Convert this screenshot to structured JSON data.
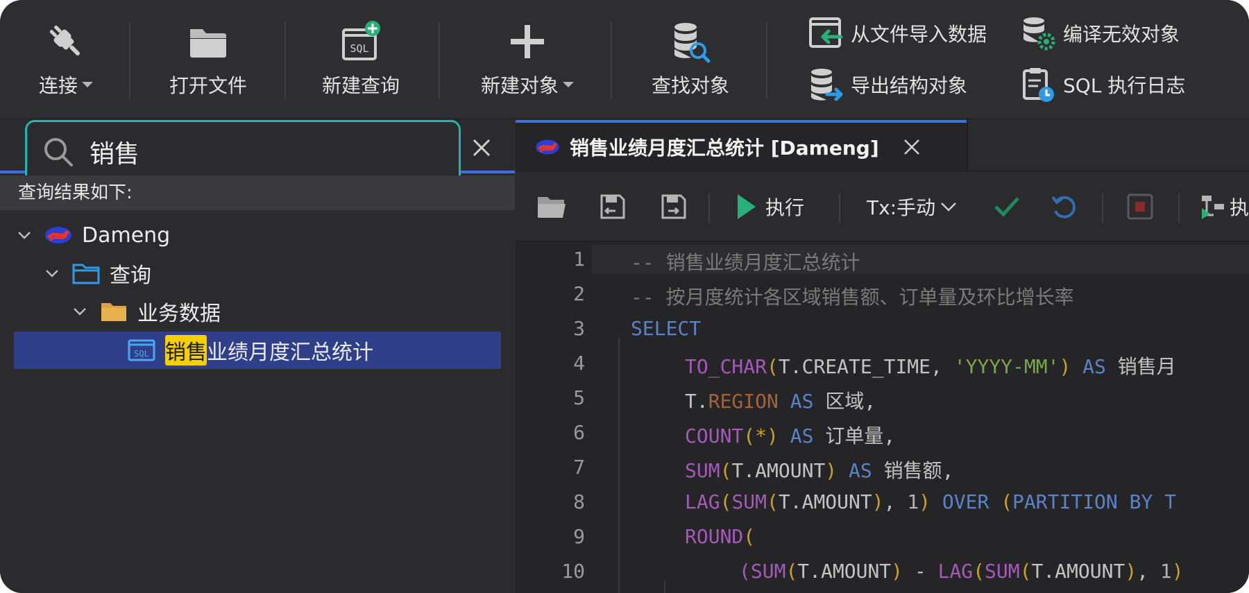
{
  "toolbar": {
    "connect": "连接",
    "open_file": "打开文件",
    "new_query": "新建查询",
    "new_object": "新建对象",
    "find_object": "查找对象",
    "import_data": "从文件导入数据",
    "compile_invalid": "编译无效对象",
    "export_structure": "导出结构对象",
    "sql_log": "SQL 执行日志"
  },
  "search": {
    "value": "销售"
  },
  "results": {
    "header": "查询结果如下:",
    "tree": [
      {
        "label": "Dameng",
        "icon": "dameng-logo-icon"
      },
      {
        "label": "查询",
        "icon": "folder-outline-icon"
      },
      {
        "label": "业务数据",
        "icon": "folder-icon"
      },
      {
        "label_highlight": "销售",
        "label_rest": "业绩月度汇总统计",
        "icon": "sql-file-icon",
        "selected": true
      }
    ]
  },
  "editor": {
    "tab_title": "销售业绩月度汇总统计 [Dameng]",
    "toolbar": {
      "execute": "执行",
      "tx_mode": "Tx:手动",
      "explain_partial": "执"
    },
    "line_numbers": [
      "1",
      "2",
      "3",
      "4",
      "5",
      "6",
      "7",
      "8",
      "9",
      "10"
    ],
    "code": {
      "l1": "-- 销售业绩月度汇总统计",
      "l2": "-- 按月度统计各区域销售额、订单量及环比增长率",
      "l3": "SELECT",
      "l4_fn": "TO_CHAR",
      "l4_p1": "(",
      "l4_arg": "T.CREATE_TIME, ",
      "l4_str": "'YYYY-MM'",
      "l4_p2": ")",
      "l4_as": " AS ",
      "l4_alias": "销售月",
      "l5_t": "T.",
      "l5_col": "REGION",
      "l5_as": " AS ",
      "l5_alias": "区域,",
      "l6_fn": "COUNT",
      "l6_args": "(*)",
      "l6_as": " AS ",
      "l6_alias": "订单量,",
      "l7_fn": "SUM",
      "l7_p1": "(",
      "l7_arg": "T.AMOUNT",
      "l7_p2": ")",
      "l7_as": " AS ",
      "l7_alias": "销售额,",
      "l8_fn": "LAG",
      "l8_p1": "(",
      "l8_fn2": "SUM",
      "l8_p2": "(",
      "l8_arg": "T.AMOUNT",
      "l8_p3": ")",
      "l8_sep": ", ",
      "l8_num": "1",
      "l8_p4": ")",
      "l8_over": " OVER ",
      "l8_p5": "(",
      "l8_part": "PARTITION BY T",
      "l9_fn": "ROUND",
      "l9_p": "(",
      "l10_p1": "(",
      "l10_fn": "SUM",
      "l10_p2": "(",
      "l10_arg": "T.AMOUNT",
      "l10_p3": ")",
      "l10_minus": " - ",
      "l10_fn2": "LAG",
      "l10_p4": "(",
      "l10_fn3": "SUM",
      "l10_p5": "(",
      "l10_arg2": "T.AMOUNT",
      "l10_p6": ")",
      "l10_sep": ", ",
      "l10_num": "1",
      "l10_p7": ")"
    }
  },
  "colors": {
    "accent_blue": "#3d6fe0",
    "search_border": "#1fb5b0",
    "selection": "#2f3f8a",
    "highlight": "#f5d000",
    "run_green": "#29b07a"
  }
}
